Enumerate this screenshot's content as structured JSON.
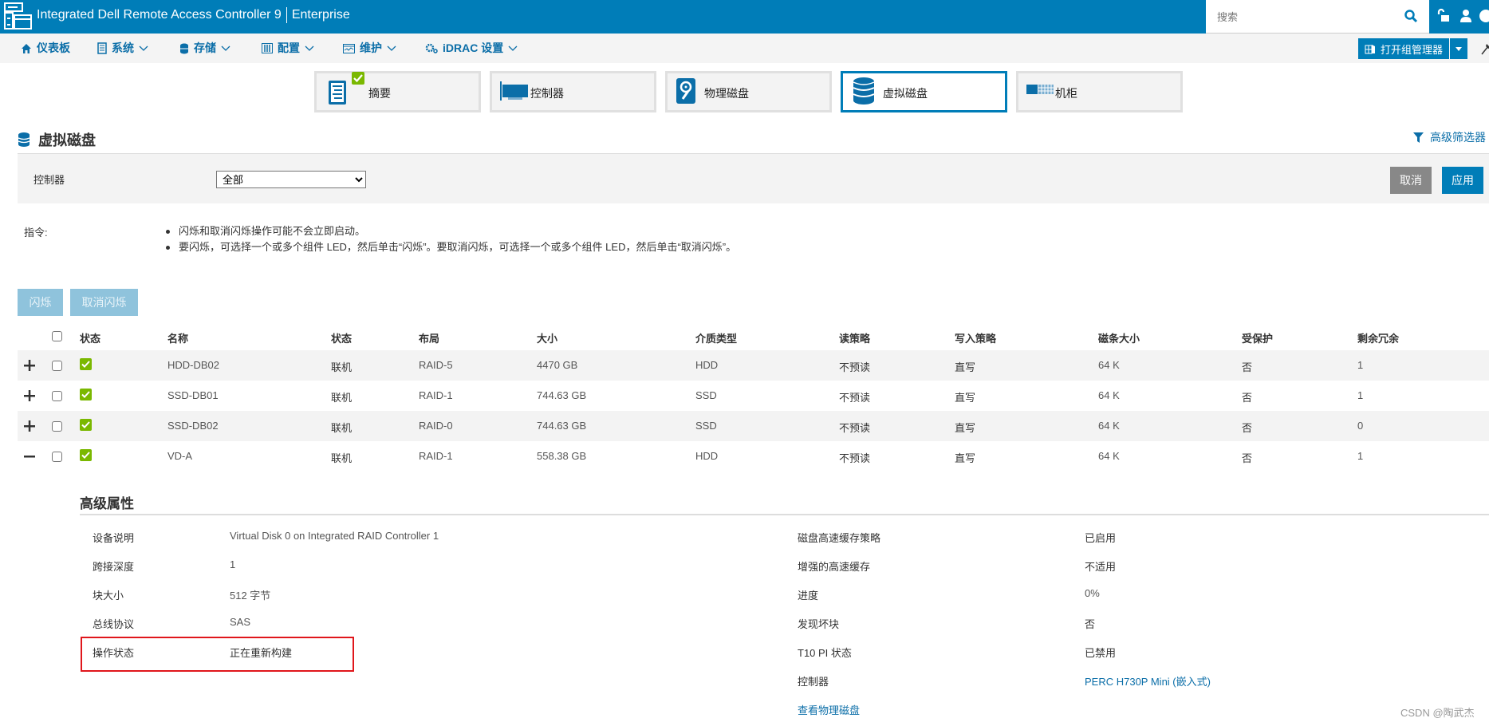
{
  "header": {
    "app_title": "Integrated Dell Remote Access Controller 9",
    "edition": "Enterprise",
    "search_placeholder": "搜索",
    "brand_color": "#007db8"
  },
  "nav": {
    "items": [
      {
        "label": "仪表板",
        "icon": "home-icon",
        "has_dropdown": false
      },
      {
        "label": "系统",
        "icon": "system-icon",
        "has_dropdown": true
      },
      {
        "label": "存储",
        "icon": "storage-icon",
        "has_dropdown": true
      },
      {
        "label": "配置",
        "icon": "configuration-icon",
        "has_dropdown": true
      },
      {
        "label": "维护",
        "icon": "maintenance-icon",
        "has_dropdown": true
      },
      {
        "label": "iDRAC 设置",
        "icon": "gear-icon",
        "has_dropdown": true
      }
    ],
    "group_manager_label": "打开组管理器"
  },
  "tabs": [
    {
      "label": "摘要",
      "icon": "summary-icon",
      "active": false,
      "badge": "check"
    },
    {
      "label": "控制器",
      "icon": "controller-icon",
      "active": false
    },
    {
      "label": "物理磁盘",
      "icon": "physical-disk-icon",
      "active": false
    },
    {
      "label": "虚拟磁盘",
      "icon": "virtual-disk-icon",
      "active": true
    },
    {
      "label": "机柜",
      "icon": "enclosure-icon",
      "active": false
    }
  ],
  "page": {
    "title": "虚拟磁盘",
    "advanced_filter_label": "高级筛选器"
  },
  "filter": {
    "controller_label": "控制器",
    "controller_value": "全部",
    "cancel_label": "取消",
    "apply_label": "应用"
  },
  "instructions": {
    "label": "指令:",
    "items": [
      "闪烁和取消闪烁操作可能不会立即启动。",
      "要闪烁，可选择一个或多个组件 LED，然后单击“闪烁”。要取消闪烁，可选择一个或多个组件 LED，然后单击“取消闪烁”。"
    ]
  },
  "actions": {
    "blink_label": "闪烁",
    "unblink_label": "取消闪烁"
  },
  "table": {
    "headers": [
      "状态",
      "名称",
      "状态",
      "布局",
      "大小",
      "介质类型",
      "读策略",
      "写入策略",
      "磁条大小",
      "受保护",
      "剩余冗余"
    ],
    "rows": [
      {
        "expanded": false,
        "expand_symbol": "+",
        "name": "HDD-DB02",
        "state": "联机",
        "layout": "RAID-5",
        "size": "4470 GB",
        "media": "HDD",
        "read_policy": "不预读",
        "write_policy": "直写",
        "stripe": "64 K",
        "secured": "否",
        "redundancy": "1"
      },
      {
        "expanded": false,
        "expand_symbol": "+",
        "name": "SSD-DB01",
        "state": "联机",
        "layout": "RAID-1",
        "size": "744.63 GB",
        "media": "SSD",
        "read_policy": "不预读",
        "write_policy": "直写",
        "stripe": "64 K",
        "secured": "否",
        "redundancy": "1"
      },
      {
        "expanded": false,
        "expand_symbol": "+",
        "name": "SSD-DB02",
        "state": "联机",
        "layout": "RAID-0",
        "size": "744.63 GB",
        "media": "SSD",
        "read_policy": "不预读",
        "write_policy": "直写",
        "stripe": "64 K",
        "secured": "否",
        "redundancy": "0"
      },
      {
        "expanded": true,
        "expand_symbol": "−",
        "name": "VD-A",
        "state": "联机",
        "layout": "RAID-1",
        "size": "558.38 GB",
        "media": "HDD",
        "read_policy": "不预读",
        "write_policy": "直写",
        "stripe": "64 K",
        "secured": "否",
        "redundancy": "1"
      }
    ]
  },
  "advanced": {
    "title": "高级属性",
    "left": [
      {
        "label": "设备说明",
        "value": "Virtual Disk 0 on Integrated RAID Controller 1"
      },
      {
        "label": "跨接深度",
        "value": "1"
      },
      {
        "label": "块大小",
        "value": "512 字节"
      },
      {
        "label": "总线协议",
        "value": "SAS"
      },
      {
        "label": "操作状态",
        "value": "正在重新构建"
      }
    ],
    "right": [
      {
        "label": "磁盘高速缓存策略",
        "value": "已启用"
      },
      {
        "label": "增强的高速缓存",
        "value": "不适用"
      },
      {
        "label": "进度",
        "value": "0%"
      },
      {
        "label": "发现坏块",
        "value": "否"
      },
      {
        "label": "T10 PI 状态",
        "value": "已禁用"
      },
      {
        "label": "控制器",
        "value": "PERC H730P Mini (嵌入式)"
      }
    ],
    "view_physical_link": "查看物理磁盘"
  },
  "watermark": "CSDN @陶武杰"
}
